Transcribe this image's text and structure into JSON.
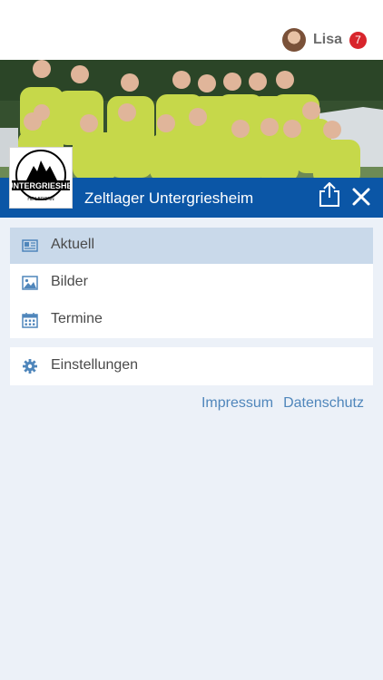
{
  "user": {
    "name": "Lisa",
    "notifications": "7"
  },
  "header": {
    "title": "Zeltlager Untergriesheim"
  },
  "logo": {
    "text": "ZELTLAGER DER SPORTFREUNDE UNTERGRIESHEIM"
  },
  "menu": {
    "items": [
      {
        "label": "Aktuell",
        "icon": "newspaper-icon",
        "active": true
      },
      {
        "label": "Bilder",
        "icon": "image-icon",
        "active": false
      },
      {
        "label": "Termine",
        "icon": "calendar-icon",
        "active": false
      }
    ],
    "settings": {
      "label": "Einstellungen",
      "icon": "gear-icon"
    }
  },
  "footer": {
    "impressum": "Impressum",
    "datenschutz": "Datenschutz"
  },
  "colors": {
    "accent": "#0b56a6",
    "badge": "#d8252c",
    "link": "#4f86bb",
    "active_row": "#c9d9ea",
    "background": "#ecf1f8"
  }
}
